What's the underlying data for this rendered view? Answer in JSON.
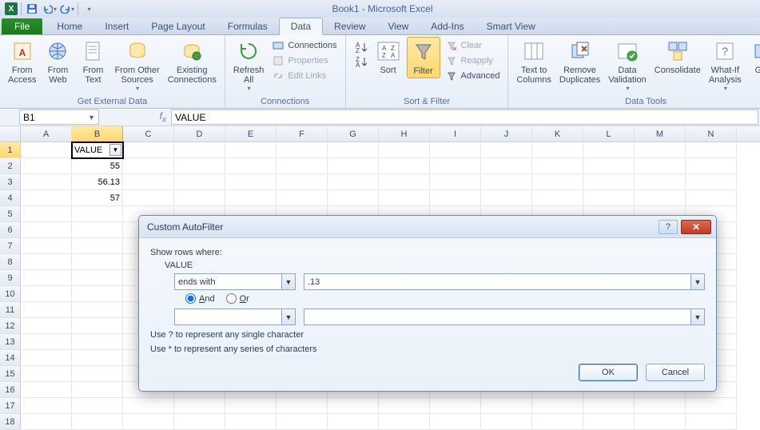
{
  "app": {
    "title": "Book1 - Microsoft Excel"
  },
  "tabs": {
    "file": "File",
    "items": [
      "Home",
      "Insert",
      "Page Layout",
      "Formulas",
      "Data",
      "Review",
      "View",
      "Add-Ins",
      "Smart View"
    ],
    "active": "Data"
  },
  "ribbon": {
    "getdata": {
      "title": "Get External Data",
      "access": "From\nAccess",
      "web": "From\nWeb",
      "text": "From\nText",
      "other": "From Other\nSources",
      "existing": "Existing\nConnections"
    },
    "connections": {
      "title": "Connections",
      "refresh": "Refresh\nAll",
      "conn": "Connections",
      "props": "Properties",
      "edit": "Edit Links"
    },
    "sortfilter": {
      "title": "Sort & Filter",
      "sort": "Sort",
      "filter": "Filter",
      "clear": "Clear",
      "reapply": "Reapply",
      "advanced": "Advanced"
    },
    "datatools": {
      "title": "Data Tools",
      "t2c": "Text to\nColumns",
      "dup": "Remove\nDuplicates",
      "valid": "Data\nValidation",
      "consol": "Consolidate",
      "whatif": "What-If\nAnalysis",
      "group": "Gro"
    }
  },
  "namebox": "B1",
  "formula": "VALUE",
  "columns": [
    "A",
    "B",
    "C",
    "D",
    "E",
    "F",
    "G",
    "H",
    "I",
    "J",
    "K",
    "L",
    "M",
    "N"
  ],
  "rows": 18,
  "data": {
    "B1": "VALUE",
    "B2": "55",
    "B3": "56.13",
    "B4": "57"
  },
  "dialog": {
    "title": "Custom AutoFilter",
    "show": "Show rows where:",
    "field": "VALUE",
    "op1": "ends with",
    "val1": ".13",
    "and": "And",
    "or": "Or",
    "op2": "",
    "val2": "",
    "hint1": "Use ? to represent any single character",
    "hint2": "Use * to represent any series of characters",
    "ok": "OK",
    "cancel": "Cancel"
  }
}
